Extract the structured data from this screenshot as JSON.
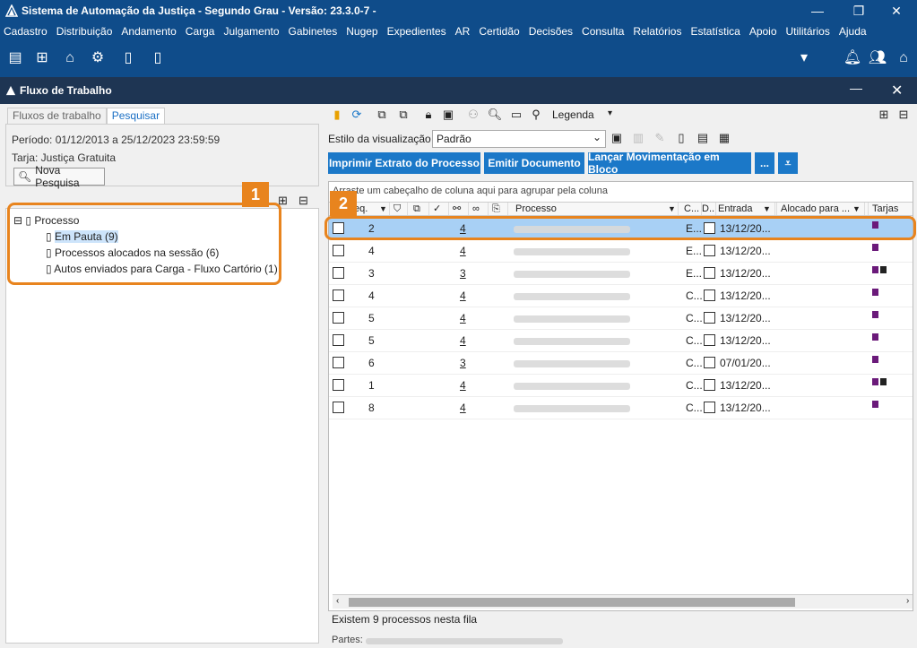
{
  "window": {
    "title": "Sistema de Automação da Justiça - Segundo Grau - Versão: 23.3.0-7 -"
  },
  "menu": [
    "Cadastro",
    "Distribuição",
    "Andamento",
    "Carga",
    "Julgamento",
    "Gabinetes",
    "Nugep",
    "Expedientes",
    "AR",
    "Certidão",
    "Decisões",
    "Consulta",
    "Relatórios",
    "Estatística",
    "Apoio",
    "Utilitários",
    "Ajuda"
  ],
  "panel": {
    "title": "Fluxo de Trabalho"
  },
  "left": {
    "tabs": [
      "Fluxos de trabalho",
      "Pesquisar"
    ],
    "periodo": "Período: 01/12/2013 a 25/12/2023 23:59:59",
    "tarja": "Tarja: Justiça Gratuita",
    "nova_pesquisa": "Nova Pesquisa",
    "tree": {
      "root": "Processo",
      "items": [
        "Em Pauta (9)",
        "Processos alocados na sessão (6)",
        "Autos enviados para Carga - Fluxo Cartório (1)"
      ]
    }
  },
  "right": {
    "legenda": "Legenda",
    "estilo_label": "Estilo da visualização",
    "estilo_value": "Padrão",
    "buttons": [
      "Imprimir Extrato do Processo",
      "Emitir Documento",
      "Lançar Movimentação em Bloco",
      "..."
    ],
    "group_hint": "Arraste um cabeçalho de coluna aqui para agrupar pela coluna",
    "columns": {
      "seq": "eq.",
      "processo": "Processo",
      "c": "C...",
      "d": "D...",
      "entrada": "Entrada",
      "alocado": "Alocado para ...",
      "tarjas": "Tarjas"
    },
    "rows": [
      {
        "seq": "2",
        "n": "4",
        "c": "E...",
        "entrada": "13/12/20...",
        "tarjas": [
          "#6b1a7a"
        ]
      },
      {
        "seq": "4",
        "n": "4",
        "c": "E...",
        "entrada": "13/12/20...",
        "tarjas": [
          "#6b1a7a"
        ]
      },
      {
        "seq": "3",
        "n": "3",
        "c": "E...",
        "entrada": "13/12/20...",
        "tarjas": [
          "#6b1a7a",
          "#222222"
        ]
      },
      {
        "seq": "4",
        "n": "4",
        "c": "C...",
        "entrada": "13/12/20...",
        "tarjas": [
          "#6b1a7a"
        ]
      },
      {
        "seq": "5",
        "n": "4",
        "c": "C...",
        "entrada": "13/12/20...",
        "tarjas": [
          "#6b1a7a"
        ]
      },
      {
        "seq": "5",
        "n": "4",
        "c": "C...",
        "entrada": "13/12/20...",
        "tarjas": [
          "#6b1a7a"
        ]
      },
      {
        "seq": "6",
        "n": "3",
        "c": "C...",
        "entrada": "07/01/20...",
        "tarjas": [
          "#6b1a7a"
        ]
      },
      {
        "seq": "1",
        "n": "4",
        "c": "C...",
        "entrada": "13/12/20...",
        "tarjas": [
          "#6b1a7a",
          "#222222"
        ]
      },
      {
        "seq": "8",
        "n": "4",
        "c": "C...",
        "entrada": "13/12/20...",
        "tarjas": [
          "#6b1a7a"
        ]
      }
    ],
    "footer": "Existem 9 processos nesta fila",
    "partes_label": "Partes:"
  },
  "callouts": [
    "1",
    "2"
  ],
  "colors": {
    "primary": "#0f4c8a",
    "accent": "#e8841e",
    "button": "#1b78c8",
    "selected_row": "#a8d0f5"
  }
}
